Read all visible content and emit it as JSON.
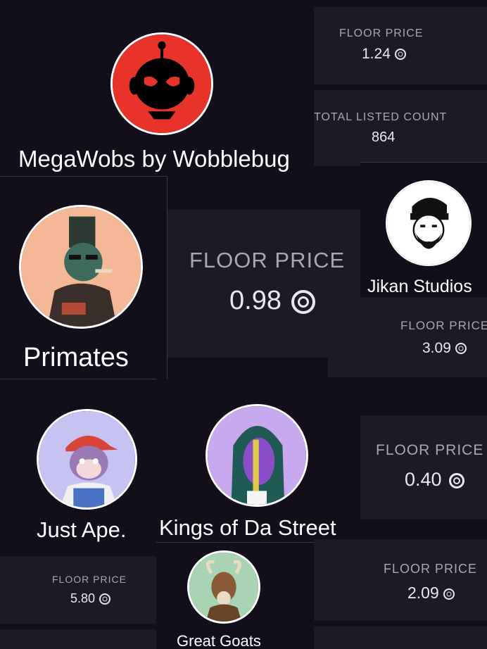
{
  "tiles": {
    "megawobs": {
      "name": "MegaWobs by Wobblebug",
      "avatar": "red-robot-avatar"
    },
    "floor_1": {
      "label": "FLOOR PRICE",
      "value": "1.24",
      "currency_icon": "sol-icon"
    },
    "listed_1": {
      "label": "TOTAL LISTED COUNT",
      "value": "864"
    },
    "primates": {
      "name": "Primates",
      "avatar": "primate-avatar"
    },
    "floor_2": {
      "label": "FLOOR PRICE",
      "value": "0.98",
      "currency_icon": "sol-icon"
    },
    "jikan": {
      "name": "Jikan Studios",
      "avatar": "bearded-man-avatar"
    },
    "floor_3": {
      "label": "FLOOR PRICE",
      "value": "3.09",
      "currency_icon": "sol-icon"
    },
    "just_ape": {
      "name": "Just Ape.",
      "avatar": "ape-avatar"
    },
    "kings": {
      "name": "Kings of Da Street",
      "avatar": "hooded-lion-avatar"
    },
    "floor_4": {
      "label": "FLOOR PRICE",
      "value": "0.40",
      "currency_icon": "sol-icon"
    },
    "floor_5": {
      "label": "FLOOR PRICE",
      "value": "5.80",
      "currency_icon": "sol-icon"
    },
    "great_goats": {
      "name": "Great Goats",
      "avatar": "goat-avatar"
    },
    "floor_6": {
      "label": "FLOOR PRICE",
      "value": "2.09",
      "currency_icon": "sol-icon"
    }
  },
  "colors": {
    "background": "#120e1a",
    "panel": "#1b1a26",
    "label": "#a9a7b1",
    "value": "#e9e8ee"
  }
}
